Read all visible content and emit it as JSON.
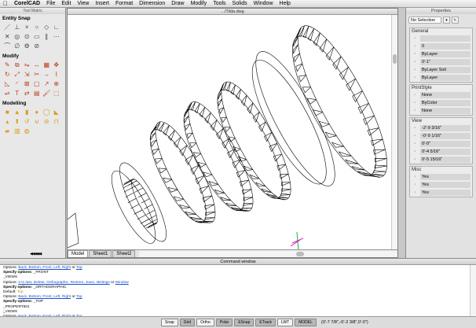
{
  "menubar": {
    "items": [
      "CorelCAD",
      "File",
      "Edit",
      "View",
      "Insert",
      "Format",
      "Dimension",
      "Draw",
      "Modify",
      "Tools",
      "Solids",
      "Window",
      "Help"
    ]
  },
  "tool_matrix": {
    "title": "Tool Matrix",
    "sections": [
      {
        "label": "Entity Snap",
        "icons": [
          "endpoint-snap",
          "midpoint-snap",
          "intersection-snap",
          "perpendicular-snap",
          "nearest-snap",
          "tangent-snap",
          "quadrant-snap",
          "center-snap",
          "insertion-snap",
          "node-snap",
          "parallel-snap",
          "extension-snap",
          "apparent-snap",
          "snap-off",
          "snap-settings",
          "snap-clear"
        ]
      },
      {
        "label": "Modify",
        "icons": [
          "erase",
          "copy",
          "mirror",
          "offset",
          "array",
          "move",
          "rotate",
          "scale",
          "stretch",
          "trim",
          "extend",
          "break",
          "chamfer",
          "fillet",
          "explode",
          "edit-poly",
          "lengthen",
          "join",
          "align",
          "text-edit",
          "flip",
          "properties",
          "paint",
          "group"
        ]
      },
      {
        "label": "Modelling",
        "icons": [
          "box",
          "cone",
          "cylinder",
          "sphere",
          "torus",
          "wedge",
          "pyramid",
          "extrude",
          "revolve",
          "union",
          "subtract",
          "intersect",
          "slice",
          "section",
          "interfere"
        ]
      }
    ],
    "pager": "◀◀◀◀◀"
  },
  "document": {
    "title": ".../Tilda.dwg",
    "tabs": [
      "Model",
      "Sheet1",
      "Sheet2"
    ],
    "active_tab": "Model"
  },
  "properties": {
    "title": "Properties",
    "selection": "No Selection",
    "groups": [
      {
        "title": "General",
        "rows": [
          {
            "icon": "color-icon",
            "value": ""
          },
          {
            "icon": "layer-icon",
            "value": "0"
          },
          {
            "icon": "linetype-icon",
            "value": "ByLayer"
          },
          {
            "icon": "scale-icon",
            "value": "0'-1\""
          },
          {
            "icon": "lineweight-icon",
            "value": "ByLayer    Soli"
          },
          {
            "icon": "thickness-icon",
            "value": "ByLayer"
          }
        ]
      },
      {
        "title": "PrintStyle",
        "rows": [
          {
            "icon": "style-icon",
            "value": "None"
          },
          {
            "icon": "color-icon",
            "value": "ByColor"
          },
          {
            "icon": "table-icon",
            "value": "None"
          }
        ]
      },
      {
        "title": "View",
        "rows": [
          {
            "icon": "x-icon",
            "value": "-2'-9 3/16\""
          },
          {
            "icon": "y-icon",
            "value": "-0'-9 1/16\""
          },
          {
            "icon": "z-icon",
            "value": "0'-0\""
          },
          {
            "icon": "height-icon",
            "value": "0'-4 5/16\""
          },
          {
            "icon": "width-icon",
            "value": "0'-5 15/16\""
          }
        ]
      },
      {
        "title": "Misc",
        "rows": [
          {
            "icon": "ucs-icon",
            "value": "Yes"
          },
          {
            "icon": "ucs-origin-icon",
            "value": "Yes"
          },
          {
            "icon": "ucs-view-icon",
            "value": "Yes"
          }
        ]
      }
    ]
  },
  "command_window": {
    "title": "Command window",
    "lines": [
      {
        "parts": [
          {
            "t": "Options: ",
            "s": "n"
          },
          {
            "t": "Back, Bottom, Front, Left, Right",
            "s": "o"
          },
          {
            "t": " or ",
            "s": "n"
          },
          {
            "t": "Top",
            "s": "o"
          }
        ]
      },
      {
        "parts": [
          {
            "t": "Specify options:",
            "s": "b"
          },
          {
            "t": " _FRONT",
            "s": "n"
          }
        ]
      },
      {
        "parts": [
          {
            "t": "  _VIEWS",
            "s": "n"
          }
        ]
      },
      {
        "parts": [
          {
            "t": "Options: ",
            "s": "n"
          },
          {
            "t": "3 to last, Delete, Orthographic, Restore, Save, sEttings",
            "s": "o"
          },
          {
            "t": " or ",
            "s": "n"
          },
          {
            "t": "Window",
            "s": "o"
          }
        ]
      },
      {
        "parts": [
          {
            "t": "Specify options:",
            "s": "b"
          },
          {
            "t": " _ORTHOGRAPHIC",
            "s": "n"
          }
        ]
      },
      {
        "parts": [
          {
            "t": "Default: ",
            "s": "n"
          },
          {
            "t": "Top",
            "s": "y"
          }
        ]
      },
      {
        "parts": [
          {
            "t": "Options: ",
            "s": "n"
          },
          {
            "t": "Back, Bottom, Front, Left, Right",
            "s": "o"
          },
          {
            "t": " or ",
            "s": "n"
          },
          {
            "t": "Top",
            "s": "o"
          }
        ]
      },
      {
        "parts": [
          {
            "t": "Specify options:",
            "s": "b"
          },
          {
            "t": " _TOP",
            "s": "n"
          }
        ]
      },
      {
        "parts": [
          {
            "t": "  _PROPERTIES",
            "s": "n"
          }
        ]
      },
      {
        "parts": [
          {
            "t": "  _VIEWS",
            "s": "n"
          }
        ]
      },
      {
        "parts": [
          {
            "t": "Options: ",
            "s": "n"
          },
          {
            "t": "Back, Bottom, Front, Left, Right",
            "s": "o"
          },
          {
            "t": " or ",
            "s": "n"
          },
          {
            "t": "Top",
            "s": "o"
          }
        ]
      }
    ],
    "prompt": ":"
  },
  "statusbar": {
    "toggles": [
      {
        "label": "Snap",
        "on": false
      },
      {
        "label": "Grid",
        "on": true
      },
      {
        "label": "Ortho",
        "on": false
      },
      {
        "label": "Polar",
        "on": true
      },
      {
        "label": "ESnap",
        "on": true
      },
      {
        "label": "ETrack",
        "on": true
      },
      {
        "label": "LWT",
        "on": false
      },
      {
        "label": "MODEL",
        "on": true
      }
    ],
    "coords": "(0'-7 7/8\",-0'-2 3/8\",0'-0\")"
  },
  "colors": {
    "cmd_option": "#1c4fd0",
    "cmd_default": "#d08a00",
    "ucs_icon": "#d020c0",
    "ucs_axis": "#20b040"
  }
}
